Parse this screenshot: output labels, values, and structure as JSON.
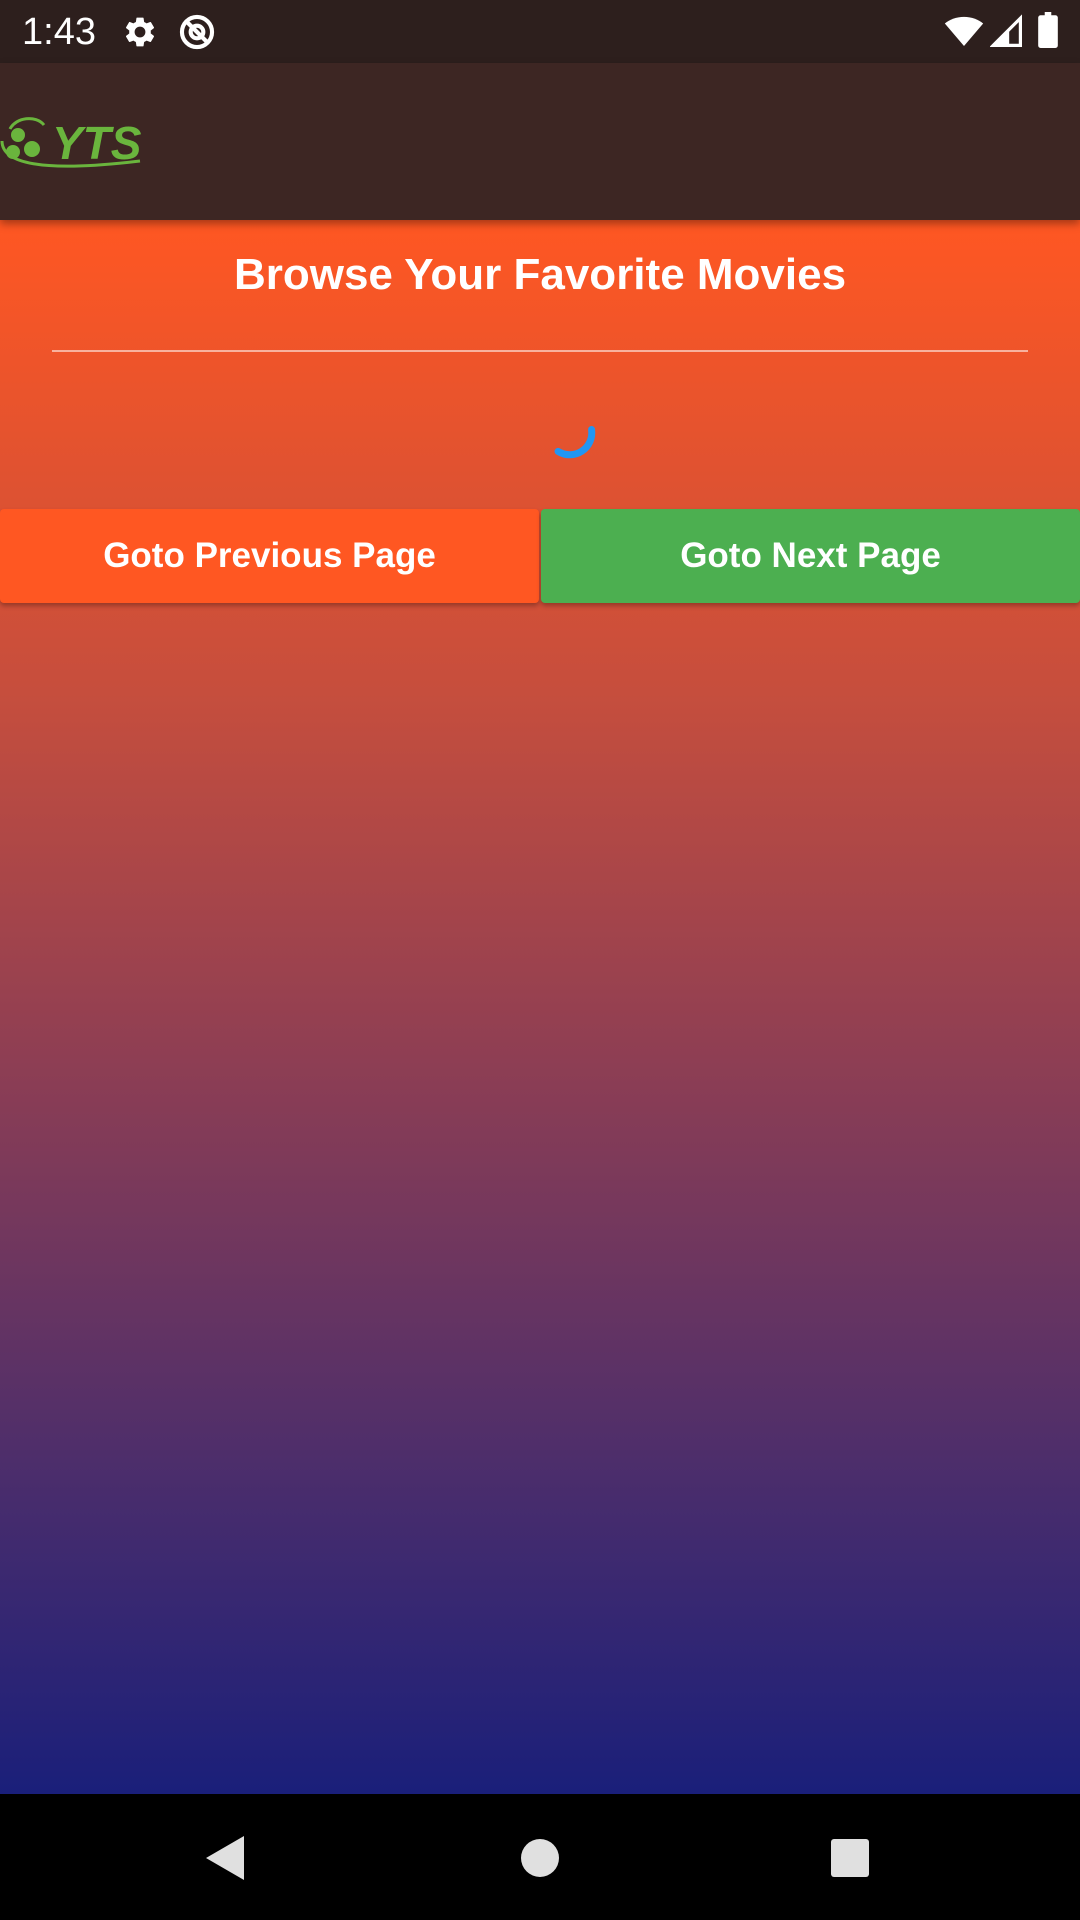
{
  "status_bar": {
    "time": "1:43",
    "icons": [
      "settings-icon",
      "at-sign-icon",
      "wifi-icon",
      "signal-icon",
      "battery-icon"
    ],
    "background": "#2d1f1d"
  },
  "app_bar": {
    "logo_text": "YTS",
    "logo_color": "#6ab53d",
    "background": "#3d2623"
  },
  "main": {
    "title": "Browse Your Favorite Movies",
    "loading_indicator": "spinner",
    "spinner_color": "#2196f3",
    "gradient_colors": [
      "#ff5722",
      "#1a1f7a"
    ]
  },
  "pagination": {
    "previous_label": "Goto Previous Page",
    "next_label": "Goto Next Page",
    "previous_color": "#ff5722",
    "next_color": "#4caf50"
  },
  "nav_bar": {
    "icons": [
      "back-icon",
      "home-icon",
      "recents-icon"
    ]
  }
}
